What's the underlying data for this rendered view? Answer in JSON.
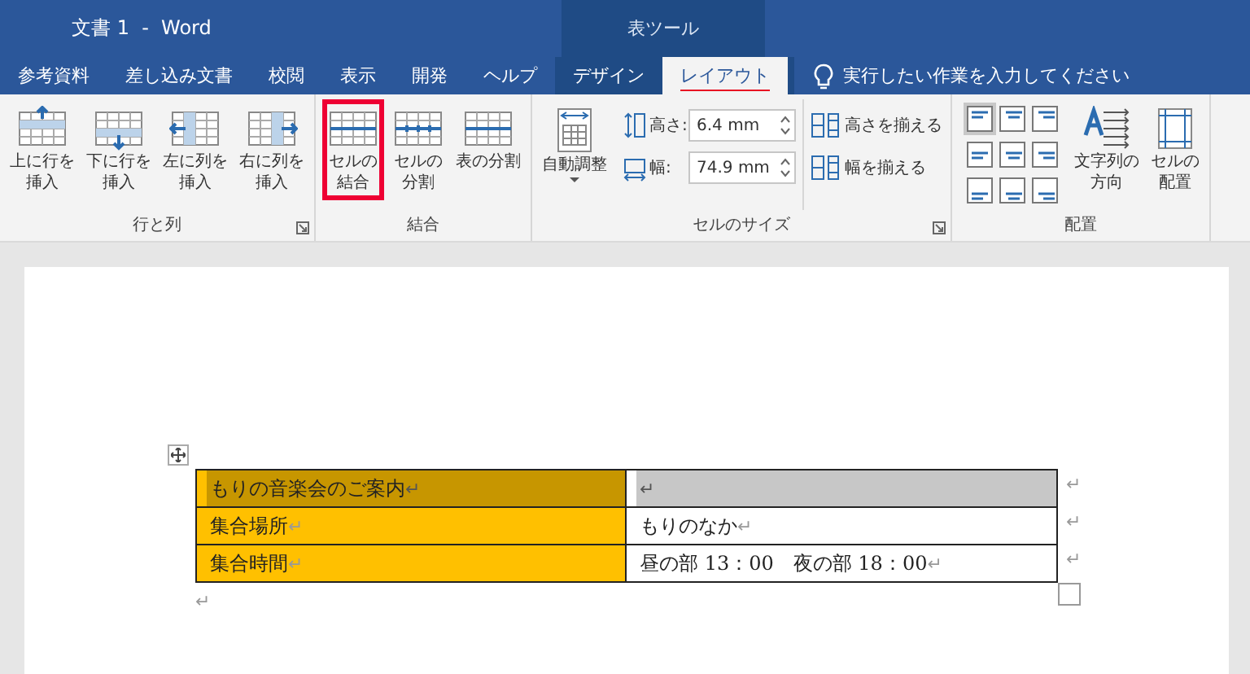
{
  "window": {
    "title": "文書 1  -  Word",
    "context_title": "表ツール"
  },
  "tabs": [
    {
      "label": "参考資料",
      "selected": false,
      "context": false
    },
    {
      "label": "差し込み文書",
      "selected": false,
      "context": false
    },
    {
      "label": "校閲",
      "selected": false,
      "context": false
    },
    {
      "label": "表示",
      "selected": false,
      "context": false
    },
    {
      "label": "開発",
      "selected": false,
      "context": false
    },
    {
      "label": "ヘルプ",
      "selected": false,
      "context": false
    },
    {
      "label": "デザイン",
      "selected": false,
      "context": true
    },
    {
      "label": "レイアウト",
      "selected": true,
      "context": true
    }
  ],
  "tell_me": {
    "placeholder": "実行したい作業を入力してください"
  },
  "ribbon": [
    {
      "label": "行と列",
      "launcher": true,
      "controls": [
        {
          "kind": "large",
          "label": "上に行を挿入",
          "highlighted": false
        },
        {
          "kind": "large",
          "label": "下に行を挿入",
          "highlighted": false
        },
        {
          "kind": "large",
          "label": "左に列を挿入",
          "highlighted": false
        },
        {
          "kind": "large",
          "label": "右に列を挿入",
          "highlighted": false
        }
      ]
    },
    {
      "label": "結合",
      "launcher": false,
      "controls": [
        {
          "kind": "large",
          "label": "セルの結合",
          "highlighted": true
        },
        {
          "kind": "large",
          "label": "セルの分割",
          "highlighted": false
        },
        {
          "kind": "large",
          "label": "表の分割",
          "highlighted": false
        }
      ]
    },
    {
      "label": "セルのサイズ",
      "launcher": true,
      "controls": [
        {
          "kind": "dropdown",
          "label": "自動調整"
        },
        {
          "kind": "spins",
          "fields": [
            {
              "label": "高さ:",
              "value": "6.4 mm"
            },
            {
              "label": "幅:",
              "value": "74.9 mm"
            }
          ]
        },
        {
          "kind": "smalls",
          "items": [
            {
              "label": "高さを揃える"
            },
            {
              "label": "幅を揃える"
            }
          ]
        }
      ]
    },
    {
      "label": "配置",
      "launcher": false,
      "controls": [
        {
          "kind": "align",
          "cells": [
            {
              "selected": true
            },
            {
              "selected": false
            },
            {
              "selected": false
            },
            {
              "selected": false
            },
            {
              "selected": false
            },
            {
              "selected": false
            },
            {
              "selected": false
            },
            {
              "selected": false
            },
            {
              "selected": false
            }
          ]
        },
        {
          "kind": "large",
          "label": "文字列の方向",
          "highlighted": false
        },
        {
          "kind": "large",
          "label": "セルの配置",
          "highlighted": false
        }
      ]
    }
  ],
  "table": {
    "rows": [
      {
        "cells": [
          {
            "text": "もりの音楽会のご案内",
            "mark": "↵",
            "color": "#ffc000",
            "selected": true
          },
          {
            "mark": "↵",
            "color": "#ffffff",
            "selected": true
          }
        ],
        "end_mark": "↵"
      },
      {
        "cells": [
          {
            "text": "集合場所",
            "mark": "↵",
            "color": "#ffc000",
            "selected": false
          },
          {
            "text": "もりのなか",
            "mark": "↵",
            "color": "#ffffff",
            "selected": false
          }
        ],
        "end_mark": "↵"
      },
      {
        "cells": [
          {
            "text": "集合時間",
            "mark": "↵",
            "color": "#ffc000",
            "selected": false
          },
          {
            "text": "昼の部 13：00　夜の部 18：00",
            "mark": "↵",
            "color": "#ffffff",
            "selected": false
          }
        ],
        "end_mark": "↵"
      }
    ],
    "after_mark": "↵"
  }
}
